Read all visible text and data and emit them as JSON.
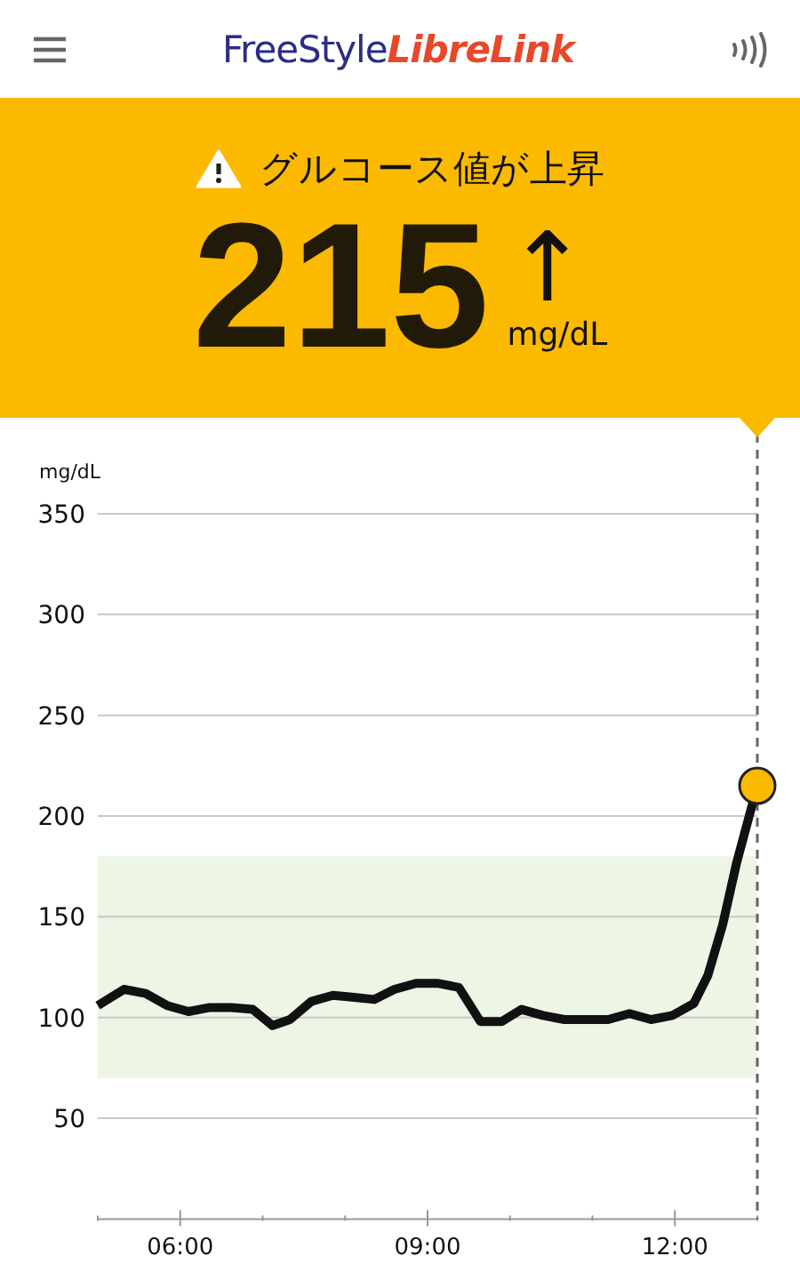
{
  "header": {
    "brand_part_1": "FreeStyle",
    "brand_part_2": "LibreLink"
  },
  "alert": {
    "message": "グルコース値が上昇",
    "value": "215",
    "unit": "mg/dL",
    "trend_arrow": "↑"
  },
  "chart": {
    "chart_data": {
      "type": "line",
      "ylabel": "mg/dL",
      "xlim": [
        5,
        13
      ],
      "ylim": [
        0,
        350
      ],
      "yticks": [
        {
          "value": 50,
          "label": "50"
        },
        {
          "value": 100,
          "label": "100"
        },
        {
          "value": 150,
          "label": "150"
        },
        {
          "value": 200,
          "label": "200"
        },
        {
          "value": 250,
          "label": "250"
        },
        {
          "value": 300,
          "label": "300"
        },
        {
          "value": 350,
          "label": "350"
        }
      ],
      "xticks": [
        {
          "value": 6,
          "label": "06:00"
        },
        {
          "value": 9,
          "label": "09:00"
        },
        {
          "value": 12,
          "label": "12:00"
        }
      ],
      "x": [
        5.0,
        5.32,
        5.58,
        5.84,
        6.1,
        6.36,
        6.62,
        6.88,
        7.12,
        7.33,
        7.59,
        7.85,
        8.11,
        8.35,
        8.6,
        8.86,
        9.12,
        9.38,
        9.64,
        9.9,
        10.14,
        10.4,
        10.66,
        10.94,
        11.19,
        11.45,
        11.71,
        11.97,
        12.23,
        12.4,
        12.58,
        12.75,
        13.0
      ],
      "series": [
        {
          "color": "#111111",
          "values": [
            106,
            114,
            112,
            106,
            103,
            105,
            105,
            104,
            96,
            99,
            108,
            111,
            110,
            109,
            114,
            117,
            117,
            115,
            98,
            98,
            104,
            101,
            99,
            99,
            99,
            102,
            99,
            101,
            107,
            121,
            146,
            177,
            215
          ]
        }
      ],
      "grid": true,
      "bands": [
        {
          "axis": "y",
          "from": 70,
          "to": 180
        }
      ]
    }
  }
}
